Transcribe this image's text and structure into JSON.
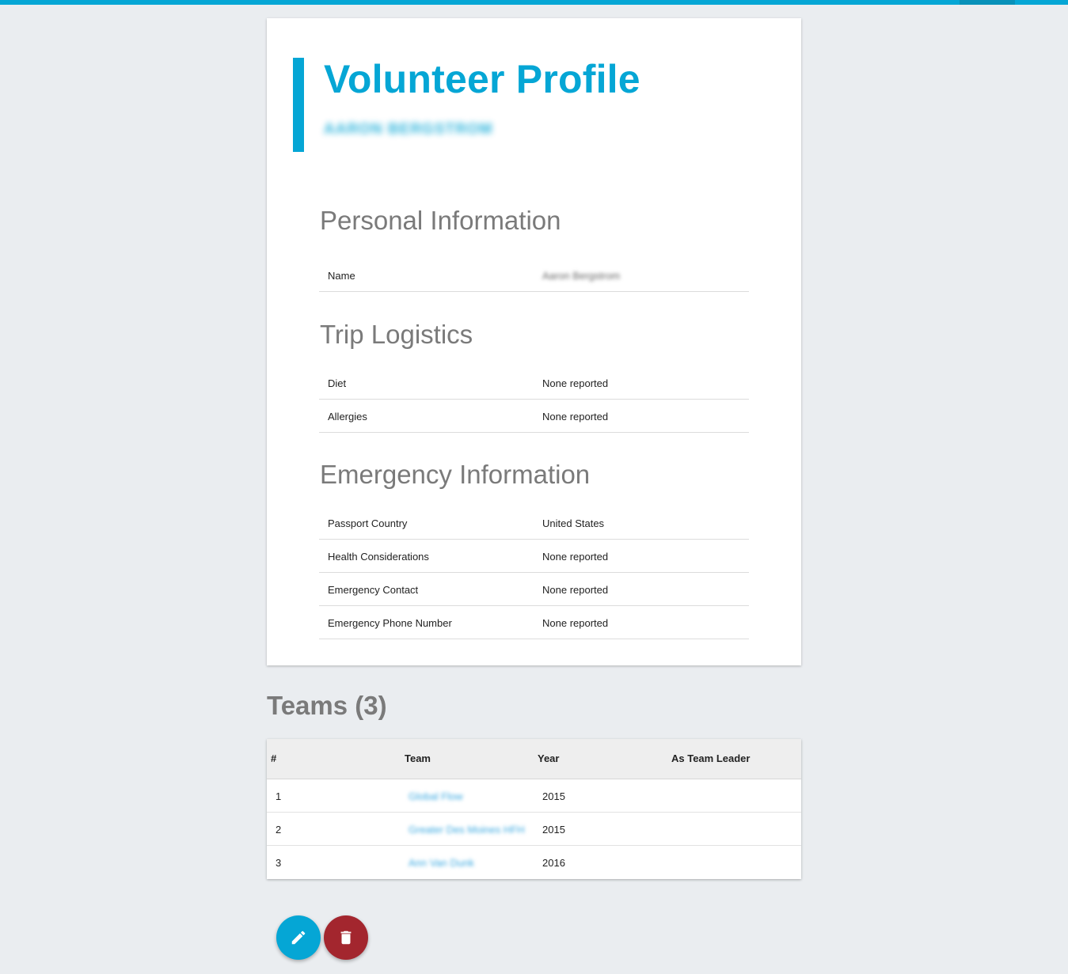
{
  "header": {
    "title": "Volunteer Profile",
    "subtitle": "AARON BERGSTROM"
  },
  "sections": [
    {
      "title": "Personal Information",
      "rows": [
        {
          "label": "Name",
          "value": "Aaron Bergstrom"
        }
      ]
    },
    {
      "title": "Trip Logistics",
      "rows": [
        {
          "label": "Diet",
          "value": "None reported"
        },
        {
          "label": "Allergies",
          "value": "None reported"
        }
      ]
    },
    {
      "title": "Emergency Information",
      "rows": [
        {
          "label": "Passport Country",
          "value": "United States"
        },
        {
          "label": "Health Considerations",
          "value": "None reported"
        },
        {
          "label": "Emergency Contact",
          "value": "None reported"
        },
        {
          "label": "Emergency Phone Number",
          "value": "None reported"
        }
      ]
    }
  ],
  "teams": {
    "title": "Teams (3)",
    "columns": [
      "#",
      "Team",
      "Year",
      "As Team Leader"
    ],
    "rows": [
      {
        "num": "1",
        "team": "Global Flow",
        "year": "2015",
        "leader": ""
      },
      {
        "num": "2",
        "team": "Greater Des Moines HFH",
        "year": "2015",
        "leader": ""
      },
      {
        "num": "3",
        "team": "Ann Van Dunk",
        "year": "2016",
        "leader": ""
      }
    ]
  },
  "actions": {
    "edit_icon": "pencil-icon",
    "delete_icon": "trash-icon"
  },
  "colors": {
    "accent": "#05a6d5",
    "danger": "#a3262e",
    "background": "#eaedf0",
    "link": "#39a8e0"
  }
}
